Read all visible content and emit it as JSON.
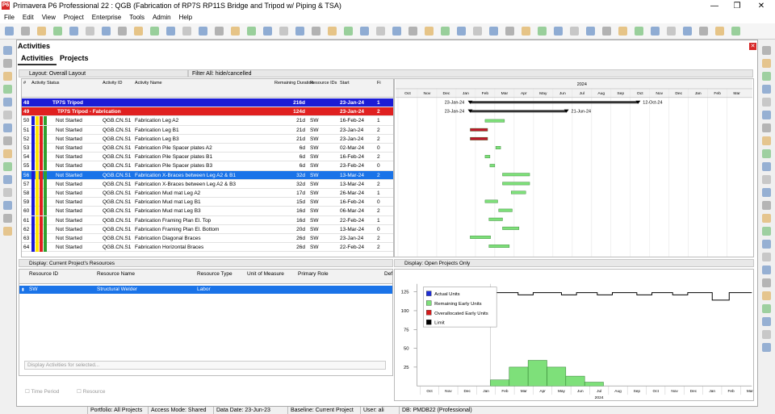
{
  "window": {
    "title": "Primavera P6 Professional 22 : QGB (Fabrication of RP7S RP11S Bridge and Tripod w/ Piping & TSA)",
    "logo": "P6"
  },
  "menu": [
    "File",
    "Edit",
    "View",
    "Project",
    "Enterprise",
    "Tools",
    "Admin",
    "Help"
  ],
  "panel": {
    "title": "Activities",
    "tabs": [
      "Activities",
      "Projects"
    ]
  },
  "layout_bar": "Layout: Overall Layout",
  "filter_bar": "Filter All: hide/cancelled",
  "grid": {
    "headers": [
      "#",
      "Activity Status",
      "Activity ID",
      "Activity Name",
      "Remaining Duration",
      "Resource IDs",
      "Start",
      "Fi"
    ],
    "rows": [
      {
        "n": "48",
        "status": "",
        "id": "",
        "name": "TP7S Tripod",
        "dur": "216d",
        "res": "",
        "start": "23-Jan-24",
        "fin": "1",
        "band": "wbs1"
      },
      {
        "n": "49",
        "status": "",
        "id": "",
        "name": "TP7S Tripod - Fabrication",
        "dur": "124d",
        "res": "",
        "start": "23-Jan-24",
        "fin": "2",
        "band": "wbs2"
      },
      {
        "n": "50",
        "status": "Not Started",
        "id": "QGB.CN.S1",
        "name": "Fabrication Leg A2",
        "dur": "21d",
        "res": "SW",
        "start": "16-Feb-24",
        "fin": "1"
      },
      {
        "n": "51",
        "status": "Not Started",
        "id": "QGB.CN.S1",
        "name": "Fabrication Leg B1",
        "dur": "21d",
        "res": "SW",
        "start": "23-Jan-24",
        "fin": "2"
      },
      {
        "n": "52",
        "status": "Not Started",
        "id": "QGB.CN.S1",
        "name": "Fabrication Leg B3",
        "dur": "21d",
        "res": "SW",
        "start": "23-Jan-24",
        "fin": "2"
      },
      {
        "n": "53",
        "status": "Not Started",
        "id": "QGB.CN.S1",
        "name": "Fabrication Pile Spacer plates A2",
        "dur": "6d",
        "res": "SW",
        "start": "02-Mar-24",
        "fin": "0"
      },
      {
        "n": "54",
        "status": "Not Started",
        "id": "QGB.CN.S1",
        "name": "Fabrication Pile Spacer plates B1",
        "dur": "6d",
        "res": "SW",
        "start": "16-Feb-24",
        "fin": "2"
      },
      {
        "n": "55",
        "status": "Not Started",
        "id": "QGB.CN.S1",
        "name": "Fabrication Pile Spacer plates B3",
        "dur": "6d",
        "res": "SW",
        "start": "23-Feb-24",
        "fin": "0"
      },
      {
        "n": "56",
        "status": "Not Started",
        "id": "QGB.CN.S1",
        "name": "Fabrication X-Braces between Leg A2 & B1",
        "dur": "32d",
        "res": "SW",
        "start": "13-Mar-24",
        "fin": "2",
        "band": "sel"
      },
      {
        "n": "57",
        "status": "Not Started",
        "id": "QGB.CN.S1",
        "name": "Fabrication X-Braces between Leg A2 & B3",
        "dur": "32d",
        "res": "SW",
        "start": "13-Mar-24",
        "fin": "2"
      },
      {
        "n": "58",
        "status": "Not Started",
        "id": "QGB.CN.S1",
        "name": "Fabrication Mud mat Leg A2",
        "dur": "17d",
        "res": "SW",
        "start": "26-Mar-24",
        "fin": "1"
      },
      {
        "n": "59",
        "status": "Not Started",
        "id": "QGB.CN.S1",
        "name": "Fabrication Mud mat Leg B1",
        "dur": "15d",
        "res": "SW",
        "start": "16-Feb-24",
        "fin": "0"
      },
      {
        "n": "60",
        "status": "Not Started",
        "id": "QGB.CN.S1",
        "name": "Fabrication Mud mat Leg B3",
        "dur": "16d",
        "res": "SW",
        "start": "06-Mar-24",
        "fin": "2"
      },
      {
        "n": "61",
        "status": "Not Started",
        "id": "QGB.CN.S1",
        "name": "Fabrication Framing Plan El. Top",
        "dur": "16d",
        "res": "SW",
        "start": "22-Feb-24",
        "fin": "1"
      },
      {
        "n": "62",
        "status": "Not Started",
        "id": "QGB.CN.S1",
        "name": "Fabrication Framing Plan El. Bottom",
        "dur": "20d",
        "res": "SW",
        "start": "13-Mar-24",
        "fin": "0"
      },
      {
        "n": "63",
        "status": "Not Started",
        "id": "QGB.CN.S1",
        "name": "Fabrication Diagonal Braces",
        "dur": "26d",
        "res": "SW",
        "start": "23-Jan-24",
        "fin": "2"
      },
      {
        "n": "64",
        "status": "Not Started",
        "id": "QGB.CN.S1",
        "name": "Fabrication Horizontal Braces",
        "dur": "26d",
        "res": "SW",
        "start": "22-Feb-24",
        "fin": "2"
      }
    ]
  },
  "gantt": {
    "year": "2024",
    "months": [
      "Oct",
      "Nov",
      "Dec",
      "Jan",
      "Feb",
      "Mar",
      "Apr",
      "May",
      "Jun",
      "Jul",
      "Aug",
      "Sep",
      "Oct",
      "Nov",
      "Dec",
      "Jan",
      "Feb",
      "Mar"
    ],
    "labels": [
      {
        "t": "23-Jan-24"
      },
      {
        "t": "12-Oct-24"
      },
      {
        "t": "23-Jan-24"
      },
      {
        "t": "21-Jun-24"
      }
    ]
  },
  "resources": {
    "display": "Display: Current Project's Resources",
    "headers": [
      "Resource ID",
      "Resource Name",
      "Resource Type",
      "Unit of Measure",
      "Primary Role",
      "Def"
    ],
    "rows": [
      {
        "id": "SW",
        "name": "Structural Welder",
        "type": "Labor",
        "uom": "",
        "role": ""
      }
    ],
    "display_activities": "Display Activities for selected...",
    "time_period": "Time Period",
    "resource": "Resource"
  },
  "graph": {
    "display": "Display: Open Projects Only",
    "legend": [
      "Actual Units",
      "Remaining Early Units",
      "Overallocated Early Units",
      "Limit"
    ],
    "legend_colors": [
      "#1f2fd6",
      "#7ee07a",
      "#d61b1b",
      "#000000"
    ],
    "y_ticks": [
      "125",
      "100",
      "75",
      "50",
      "25"
    ],
    "year": "2024",
    "months": [
      "Oct",
      "Nov",
      "Dec",
      "Jan",
      "Feb",
      "Mar",
      "Apr",
      "May",
      "Jun",
      "Jul",
      "Aug",
      "Sep",
      "Oct",
      "Nov",
      "Dec",
      "Jan",
      "Feb",
      "Mar"
    ],
    "histogram": [
      8,
      25,
      34,
      25,
      13,
      5
    ],
    "limit_note": ""
  },
  "status": [
    "Portfolio: All Projects",
    "Access Mode: Shared",
    "Data Date: 23-Jun-23",
    "Baseline: Current Project",
    "User: ali",
    "DB: PMDB22 (Professional)"
  ]
}
